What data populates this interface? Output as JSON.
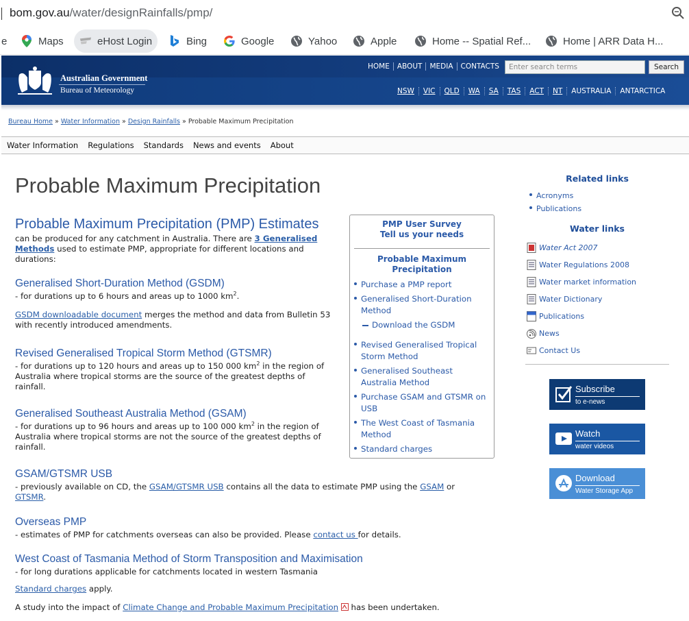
{
  "browser": {
    "url_host": "bom.gov.au",
    "url_path": "/water/designRainfalls/pmp/",
    "bookmarks": [
      {
        "label": "e"
      },
      {
        "label": "Maps"
      },
      {
        "label": "eHost Login"
      },
      {
        "label": "Bing"
      },
      {
        "label": "Google"
      },
      {
        "label": "Yahoo"
      },
      {
        "label": "Apple"
      },
      {
        "label": "Home -- Spatial Ref..."
      },
      {
        "label": "Home | ARR Data H..."
      }
    ]
  },
  "header": {
    "gov": "Australian Government",
    "bureau": "Bureau of Meteorology",
    "topnav": [
      "HOME",
      "ABOUT",
      "MEDIA",
      "CONTACTS"
    ],
    "search_placeholder": "Enter search terms",
    "search_button": "Search",
    "states": [
      "NSW",
      "VIC",
      "QLD",
      "WA",
      "SA",
      "TAS",
      "ACT",
      "NT",
      "AUSTRALIA",
      "ANTARCTICA"
    ]
  },
  "breadcrumb": {
    "home": "Bureau Home",
    "water": "Water Information",
    "design": "Design Rainfalls",
    "current": "Probable Maximum Precipitation",
    "sep": "»"
  },
  "menu": [
    "Water Information",
    "Regulations",
    "Standards",
    "News and events",
    "About"
  ],
  "page_title": "Probable Maximum Precipitation",
  "intro": {
    "heading": "Probable Maximum Precipitation (PMP) Estimates",
    "text1": "can be produced for any catchment in Australia. There are ",
    "link": "3 Generalised Methods",
    "text2": " used to estimate PMP, appropriate for different locations and durations:"
  },
  "gsdm": {
    "heading": "Generalised Short-Duration Method (GSDM)",
    "text": "- for durations up to 6 hours and areas up to 1000 km",
    "sup": "2",
    "tail": ".",
    "link": "GSDM downloadable document",
    "text2": " merges the method and data from Bulletin 53 with recently introduced amendments."
  },
  "gtsmr": {
    "heading": "Revised Generalised Tropical Storm Method (GTSMR)",
    "text": "- for durations up to 120 hours and areas up to 150 000 km",
    "sup": "2",
    "tail": " in the region of Australia where tropical storms are the source of the greatest depths of rainfall."
  },
  "gsam": {
    "heading": "Generalised Southeast Australia Method (GSAM)",
    "text": "- for durations up to 96 hours and areas up to 100 000 km",
    "sup": "2",
    "tail": " in the region of Australia where tropical storms are not the source of the greatest depths of rainfall."
  },
  "usb": {
    "heading": "GSAM/GTSMR USB",
    "text1": "- previously available on CD, the ",
    "link1": "GSAM/GTSMR USB",
    "text2": " contains all the data to estimate PMP using the ",
    "link2": "GSAM",
    "text3": " or ",
    "link3": "GTSMR",
    "text4": "."
  },
  "overseas": {
    "heading": "Overseas PMP",
    "text1": "- estimates of PMP for catchments overseas can also be provided. Please ",
    "link": "contact us ",
    "text2": "for details."
  },
  "tasmania": {
    "heading": "West Coast of Tasmania Method of Storm Transposition and Maximisation",
    "text": "- for long durations applicable for catchments located in western Tasmania"
  },
  "charges": {
    "link": "Standard charges",
    "text": " apply."
  },
  "climate": {
    "text1": "A study into the impact of ",
    "link": "Climate Change and Probable Maximum Precipitation",
    "text2": " has been undertaken."
  },
  "survey": {
    "title1": "PMP User Survey",
    "title2": "Tell us your needs",
    "section": "Probable Maximum Precipitation",
    "items": [
      "Purchase a PMP report",
      "Generalised Short-Duration Method",
      "Download the GSDM",
      "Revised Generalised Tropical Storm Method",
      "Generalised Southeast Australia Method",
      "Purchase GSAM and GTSMR on USB",
      "The West Coast of Tasmania Method",
      "Standard charges"
    ]
  },
  "related": {
    "heading": "Related links",
    "items": [
      "Acronyms",
      "Publications"
    ],
    "water_heading": "Water links",
    "water_items": [
      "Water Act 2007",
      "Water Regulations 2008",
      "Water market information",
      "Water Dictionary",
      "Publications",
      "News",
      "Contact Us"
    ]
  },
  "promos": [
    {
      "title": "Subscribe",
      "sub": "to e-news",
      "color": "#0d3a73"
    },
    {
      "title": "Watch",
      "sub": "water videos",
      "color": "#1a57a3"
    },
    {
      "title": "Download",
      "sub": "Water Storage App",
      "color": "#4a8fd6"
    }
  ],
  "colors": {
    "link": "#2a5ea8",
    "header": "#0c2f68",
    "heading": "#2b5aa8"
  }
}
